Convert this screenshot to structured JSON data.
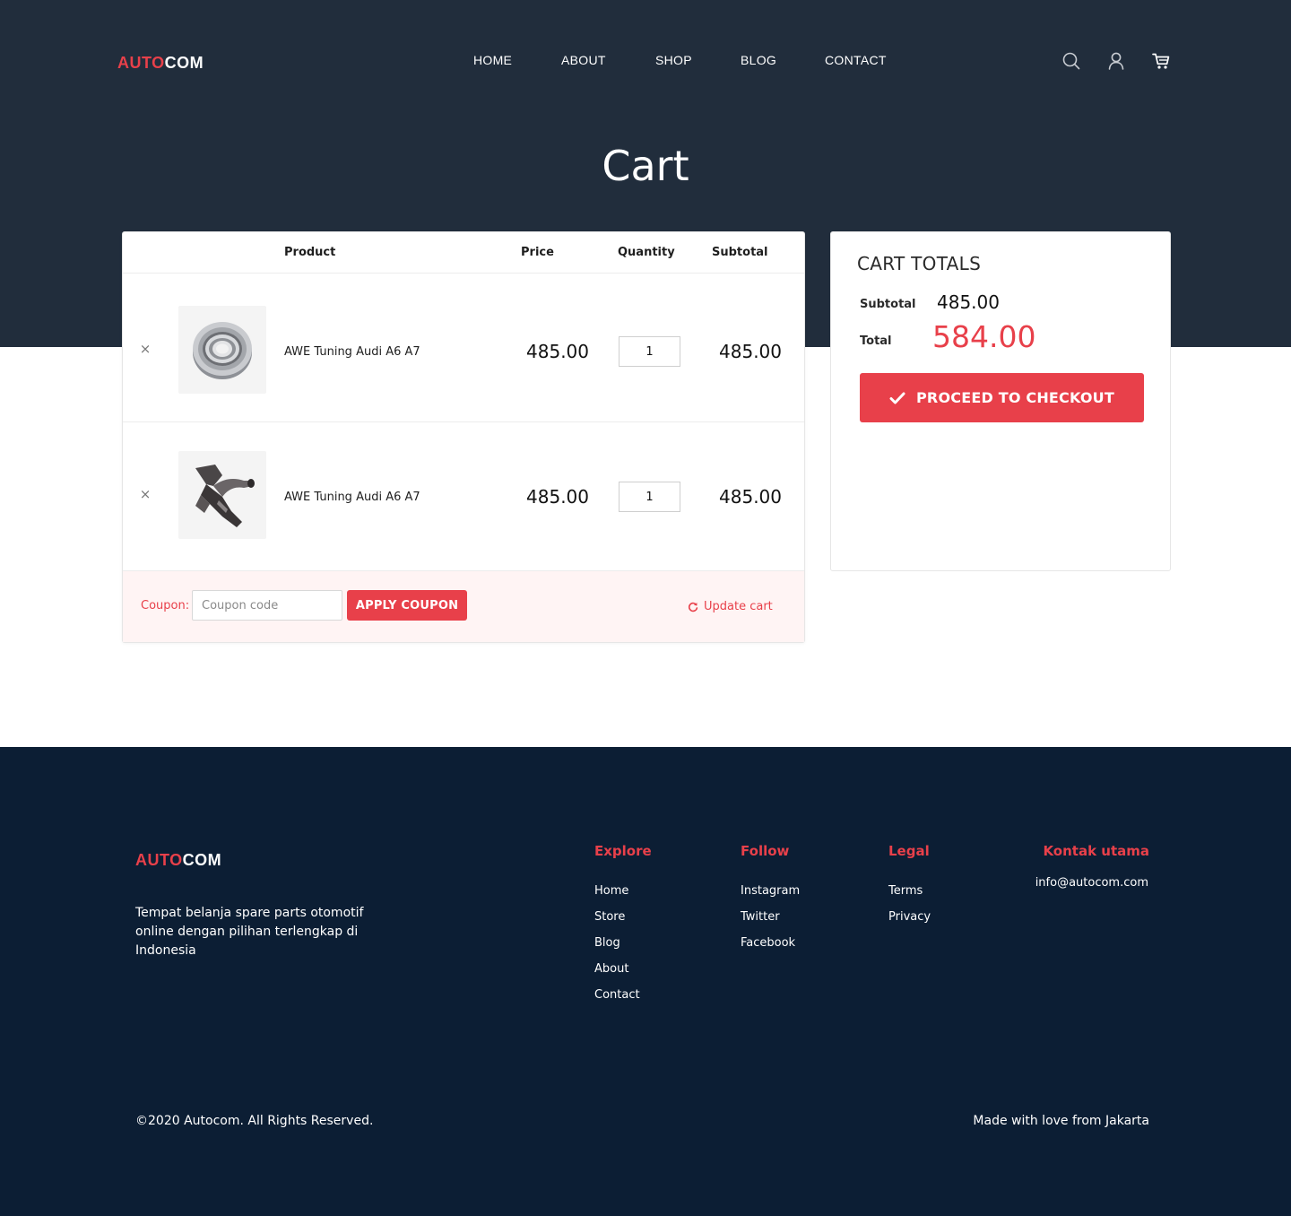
{
  "brand": {
    "part1": "AUTO",
    "part2": "COM"
  },
  "nav": {
    "items": [
      {
        "label": "HOME"
      },
      {
        "label": "ABOUT"
      },
      {
        "label": "SHOP"
      },
      {
        "label": "BLOG"
      },
      {
        "label": "CONTACT"
      }
    ]
  },
  "header_icons": [
    "search-icon",
    "user-icon",
    "cart-icon"
  ],
  "page_title": "Cart",
  "cart": {
    "columns": {
      "product": "Product",
      "price": "Price",
      "quantity": "Quantity",
      "subtotal": "Subtotal"
    },
    "remove_symbol": "×",
    "items": [
      {
        "name": "AWE Tuning Audi A6 A7",
        "price": "485.00",
        "quantity": "1",
        "subtotal": "485.00",
        "image": "wheel-bearing"
      },
      {
        "name": "AWE Tuning Audi A6 A7",
        "price": "485.00",
        "quantity": "1",
        "subtotal": "485.00",
        "image": "intake-pipe"
      }
    ],
    "coupon": {
      "label": "Coupon:",
      "placeholder": "Coupon code",
      "apply_label": "APPLY COUPON"
    },
    "update_label": "Update cart"
  },
  "totals": {
    "title": "CART TOTALS",
    "subtotal_label": "Subtotal",
    "subtotal_value": "485.00",
    "total_label": "Total",
    "total_value": "584.00",
    "checkout_label": "PROCEED TO CHECKOUT"
  },
  "footer": {
    "description": "Tempat belanja spare parts otomotif online dengan pilihan terlengkap di Indonesia",
    "columns": [
      {
        "heading": "Explore",
        "links": [
          "Home",
          "Store",
          "Blog",
          "About",
          "Contact"
        ]
      },
      {
        "heading": "Follow",
        "links": [
          "Instagram",
          "Twitter",
          "Facebook"
        ]
      },
      {
        "heading": "Legal",
        "links": [
          "Terms",
          "Privacy"
        ]
      }
    ],
    "contact": {
      "heading": "Kontak utama",
      "email": "info@autocom.com"
    },
    "copyright": "©2020 Autocom. All Rights Reserved.",
    "tagline": "Made with love from Jakarta"
  },
  "colors": {
    "accent": "#e8404a",
    "hero_bg": "#212d3c",
    "footer_bg": "#0c1e34"
  }
}
